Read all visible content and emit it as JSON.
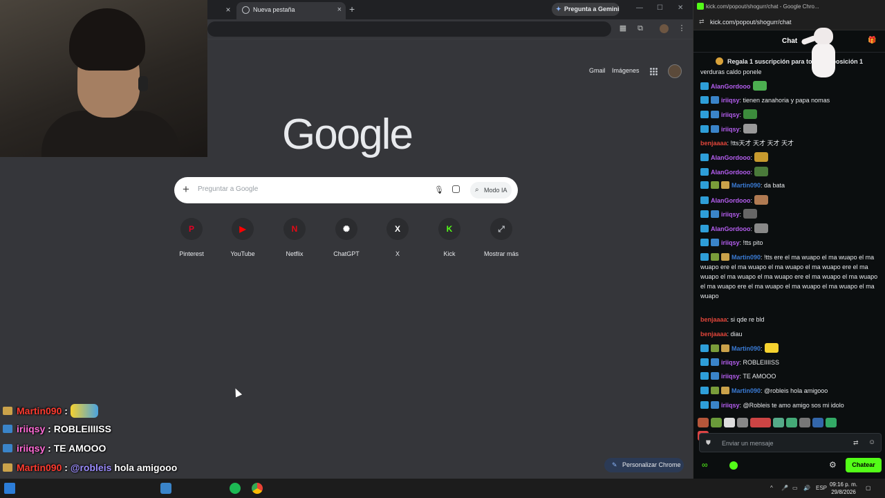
{
  "browser": {
    "prev_tab_close": "×",
    "active_tab_title": "Nueva pestaña",
    "active_tab_close": "×",
    "new_tab": "+",
    "gemini_button": "Pregunta a Gemini",
    "window_controls": [
      "—",
      "☐",
      "✕"
    ]
  },
  "newtab": {
    "gmail": "Gmail",
    "images": "Imágenes",
    "logo": "Google",
    "search_placeholder": "Preguntar a Google",
    "ai_mode": "Modo IA",
    "shortcuts": [
      {
        "label": "Pinterest",
        "glyph": "P",
        "color": "#e60023"
      },
      {
        "label": "YouTube",
        "glyph": "▶",
        "color": "#ff0000"
      },
      {
        "label": "Netflix",
        "glyph": "N",
        "color": "#e50914"
      },
      {
        "label": "ChatGPT",
        "glyph": "✺",
        "color": "#ffffff"
      },
      {
        "label": "X",
        "glyph": "X",
        "color": "#ffffff"
      },
      {
        "label": "Kick",
        "glyph": "K",
        "color": "#53fc18"
      },
      {
        "label": "Mostrar más",
        "glyph": "⤢",
        "color": "#bdc1c6"
      }
    ],
    "customize": "Personalizar Chrome"
  },
  "overlay_chat": [
    {
      "user": "Martin090",
      "user_color": "#ff3b30",
      "badge_color": "#caa24a",
      "text": "",
      "emote": true
    },
    {
      "user": "iriiqsy",
      "user_color": "#ff6ad5",
      "badge_color": "#3a84c9",
      "text": "ROBLEIIIISS",
      "emote": false
    },
    {
      "user": "iriiqsy",
      "user_color": "#ff6ad5",
      "badge_color": "#3a84c9",
      "text": "TE AMOOO",
      "emote": false
    },
    {
      "user": "Martin090",
      "user_color": "#ff3b30",
      "badge_color": "#caa24a",
      "text": "hola amigooo",
      "mention": "@robleis",
      "emote": false
    },
    {
      "user": "iriiqsy",
      "user_color": "#ff6ad5",
      "badge_color": "#3a84c9",
      "text": "te amo amigo sos mi idolo",
      "mention": "@Robleis",
      "emote": false
    }
  ],
  "chat_window": {
    "title": "kick.com/popout/shogurr/chat - Google Chro...",
    "url": "kick.com/popout/shogurr/chat",
    "header": "Chat",
    "pinned": "Regala 1 suscripción para tomar la posición 1",
    "messages": [
      {
        "user": "",
        "text": "verduras caldo ponele",
        "ucolor": "#e8eaed",
        "badges": []
      },
      {
        "user": "AlanGordooo",
        "text": "",
        "ucolor": "#b55ef0",
        "badges": [
          "b-sub"
        ],
        "emote": "#4caf50"
      },
      {
        "user": "iriiqsy",
        "text": ": tienen zanahoria y papa nomas",
        "ucolor": "#b55ef0",
        "badges": [
          "b-sub",
          "b-blue"
        ]
      },
      {
        "user": "iriiqsy",
        "text": ":",
        "ucolor": "#b55ef0",
        "badges": [
          "b-sub",
          "b-blue"
        ],
        "emote": "#3c8c3c"
      },
      {
        "user": "iriiqsy",
        "text": ":",
        "ucolor": "#b55ef0",
        "badges": [
          "b-sub",
          "b-blue"
        ],
        "emote": "#999999"
      },
      {
        "user": "benjaaaa",
        "text": ": !tts天才 天才 天才 天才",
        "ucolor": "#e0453a",
        "badges": []
      },
      {
        "user": "AlanGordooo",
        "text": ":",
        "ucolor": "#b55ef0",
        "badges": [
          "b-sub"
        ],
        "emote": "#c79a2e"
      },
      {
        "user": "AlanGordooo",
        "text": ":",
        "ucolor": "#b55ef0",
        "badges": [
          "b-sub"
        ],
        "emote": "#4a7a3a"
      },
      {
        "user": "Martin090",
        "text": ": da bata",
        "ucolor": "#3a7bd5",
        "badges": [
          "b-sub",
          "b-grn",
          "b-gold"
        ]
      },
      {
        "user": "AlanGordooo",
        "text": ":",
        "ucolor": "#b55ef0",
        "badges": [
          "b-sub"
        ],
        "emote": "#b07a52"
      },
      {
        "user": "iriiqsy",
        "text": ":",
        "ucolor": "#b55ef0",
        "badges": [
          "b-sub",
          "b-blue"
        ],
        "emote": "#666666"
      },
      {
        "user": "AlanGordooo",
        "text": ":",
        "ucolor": "#b55ef0",
        "badges": [
          "b-sub"
        ],
        "emote": "#888888"
      },
      {
        "user": "iriiqsy",
        "text": ": !tts pito",
        "ucolor": "#b55ef0",
        "badges": [
          "b-sub",
          "b-blue"
        ]
      },
      {
        "user": "Martin090",
        "text": ": !tts ere el ma wuapo el ma wuapo el ma wuapo ere el ma wuapo el ma wuapo el ma wuapo ere el ma wuapo el ma wuapo el ma wuapo ere el ma wuapo el ma wuapo el ma wuapo ere el ma wuapo el ma wuapo el ma wuapo el ma wuapo",
        "ucolor": "#3a7bd5",
        "badges": [
          "b-sub",
          "b-grn",
          "b-gold"
        ]
      },
      {
        "user": "benjaaaa",
        "text": ": si qde re bld",
        "ucolor": "#e0453a",
        "badges": []
      },
      {
        "user": "benjaaaa",
        "text": ": diau",
        "ucolor": "#e0453a",
        "badges": []
      },
      {
        "user": "Martin090",
        "text": ":",
        "ucolor": "#3a7bd5",
        "badges": [
          "b-sub",
          "b-grn",
          "b-gold"
        ],
        "emote": "#f6d22f"
      },
      {
        "user": "iriiqsy",
        "text": ": ROBLEIIIISS",
        "ucolor": "#b55ef0",
        "badges": [
          "b-sub",
          "b-blue"
        ]
      },
      {
        "user": "iriiqsy",
        "text": ": TE AMOOO",
        "ucolor": "#b55ef0",
        "badges": [
          "b-sub",
          "b-blue"
        ]
      },
      {
        "user": "Martin090",
        "text": ": @robleis hola amigooo",
        "ucolor": "#3a7bd5",
        "badges": [
          "b-sub",
          "b-grn",
          "b-gold"
        ]
      },
      {
        "user": "iriiqsy",
        "text": ": @Robleis te amo amigo sos mi idolo",
        "ucolor": "#b55ef0",
        "badges": [
          "b-sub",
          "b-blue"
        ]
      }
    ],
    "input_placeholder": "Enviar un mensaje",
    "send_button": "Chatear"
  },
  "taskbar": {
    "language": "ESP",
    "time": "09:16 p. m.",
    "date": "29/8/2026"
  }
}
